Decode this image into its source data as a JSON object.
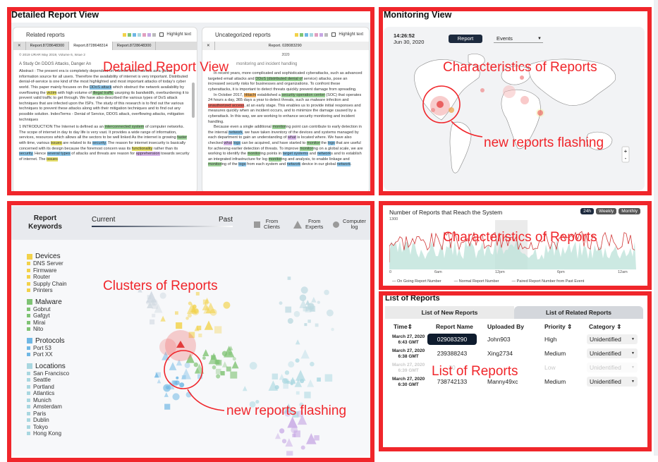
{
  "detailed": {
    "title": "Detailed Report View",
    "annotation": "Detailed Report View",
    "left_doc": {
      "header": "Related reports",
      "highlight_label": "Highlight text",
      "tabs": [
        "Report.8728648300",
        "Report.8728648314",
        "Report.8728648300"
      ],
      "citation": "© 2019 IJRAR May 2019, Volume 6, Issue 2",
      "subtitle": "A Study On DDOS Attacks, Danger An",
      "abstract": "Abstract : The present era is completely dependent on Internet which serves as a global information source for all users. Therefore the availability of internet is very important. Distributed denial-of-service is one kind of the most highlighted and most important attacks of today's cyber world. This paper mainly focuses on the DDoS attack which obstruct the network availability by overflowing the victim with high volume of illegal traffic usurping its bandwidth, overburdening it to prevent valid traffic to get through. We have also described the various types of DoS attack techniques that are infected upon the ISPs. The study of this research is to find out the various techniques to prevent these attacks along with their mitigation techniques and to find out any possible solution. IndexTerms - Denial of Service, DDOS attack, overflowing attacks, mitigation techniques",
      "intro": "1 INTRODUCTION The Internet is defined as an interconnected system of computer networks. The scope of internet in day to day life is very vast. It provides a wide range of information, services, resources which allows all the sectors to be well linked As the internet is growing faster with time, various issues are related to its security. The reason for internet insecurity is basically concerned with its design because the foremost concern was its functionality rather than its security. Hence several types of attacks and threats are reason for apprehension towards security of internet. The issues"
    },
    "right_doc": {
      "header": "Uncategorized reports",
      "highlight_label": "Highlight text",
      "tab": "Report. 028083290",
      "date": "2020",
      "subtitle": "monitoring and incident handling",
      "para1": "In recent years, more complicated and sophisticated cyberattacks, such as advanced targeted email attacks and DDoS (distributed denial of service) attacks, pose an increased security risks for businesses and organizations. To confront these cyberattacks, it is important to detect threats quickly prevent damage from spreading.",
      "para2": "In October 2017, Hitachi established a security operation center (SOC) that operates 24 hours a day, 365 days a year to detect threats, such as malware infection and unauthorized access, at an early stage. This enables us to provide initial responses and measures quickly when an incident occurs, and to minimize the damage caused by a cyberattack. In this way, we are working to enhance security monitoring and incident handling.",
      "para3": "Because even a single additional monitoring point can contribute to early detection in the internal network, we have taken inventory of the devices and systems managed by each department to gain an understanding of what is located where. We have also checked what logs can be acquired, and have started to monitor the logs that are useful for achieving earlier detection of threats. To improve monitoring on a global scale, we are working to identify the monitoring points in target systems and networks and to establish an integrated infrastructure for log monitoring and analysis, to enable linkage and monitoring of the logs from each system and network device in our global network."
    }
  },
  "monitoring": {
    "title": "Monitoring View",
    "time": "14:26:52",
    "date": "Jun 30, 2020",
    "report_btn": "Report",
    "events_select": "Events",
    "annotation_top": "Characteristics of Reports",
    "annotation_flash": "new reports flashing",
    "zoom_in": "+",
    "zoom_out": "-"
  },
  "keywords": {
    "title_line1": "Report",
    "title_line2": "Keywords",
    "current": "Current",
    "past": "Past",
    "legend_clients": [
      "From",
      "Clients"
    ],
    "legend_experts": [
      "From",
      "Experts"
    ],
    "legend_log": [
      "Computer",
      "log"
    ],
    "annotation_clusters": "Clusters of Reports",
    "annotation_flash": "new reports flashing",
    "groups": [
      {
        "name": "Devices",
        "color": "#f2d24a",
        "items": [
          "DNS Server",
          "Firmware",
          "Router",
          "Supply Chain",
          "Printers"
        ]
      },
      {
        "name": "Malware",
        "color": "#7fc374",
        "items": [
          "Gobrut",
          "Gafgyt",
          "Mirai",
          "Nito"
        ]
      },
      {
        "name": "Protocols",
        "color": "#6fb7e4",
        "items": [
          "Port 53",
          "Port XX"
        ]
      },
      {
        "name": "Locations",
        "color": "#a9d7e0",
        "items": [
          "San Francisco",
          "Seattle",
          "Portland",
          "Atlantics",
          "Munich",
          "Amsterdam",
          "Paris",
          "Dublin",
          "Tokyo",
          "Hong Kong"
        ]
      }
    ]
  },
  "timeline": {
    "title": "Number of Reports that Reach the System",
    "ymax": "1300",
    "btn_24h": "24h",
    "btn_weekly": "Weekly",
    "btn_monthly": "Monthly",
    "ticks": [
      "0",
      "6am",
      "12pm",
      "6pm",
      "12am"
    ],
    "legend": [
      "On Going Report Number",
      "Normal Report Number",
      "Paired Report Number from Past Event"
    ],
    "annotation": "Characteristics of Reports"
  },
  "list": {
    "title": "List of Reports",
    "tab_new": "List of New Reports",
    "tab_related": "List of Related Reports",
    "headers": [
      "Time",
      "Report Name",
      "Uploaded By",
      "Priority",
      "Category"
    ],
    "rows": [
      {
        "date": "March 27, 2020",
        "time": "6:43 GMT",
        "name": "029083290",
        "by": "John903",
        "priority": "High",
        "category": "Unidentified"
      },
      {
        "date": "March 27, 2020",
        "time": "6:38 GMT",
        "name": "239388243",
        "by": "Xing2734",
        "priority": "Medium",
        "category": "Unidentified"
      },
      {
        "date": "March 27, 2020",
        "time": "6:39 GMT",
        "name": "20",
        "by": "",
        "priority": "Low",
        "category": "Unidentified"
      },
      {
        "date": "March 27, 2020",
        "time": "6:30 GMT",
        "name": "738742133",
        "by": "Manny49xc",
        "priority": "Medium",
        "category": "Unidentified"
      }
    ],
    "annotation": "List of Reports"
  }
}
